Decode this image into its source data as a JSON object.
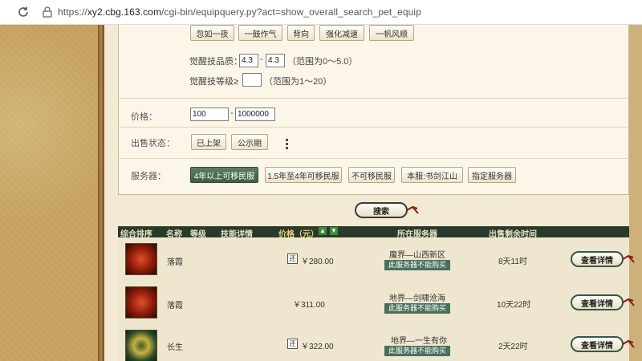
{
  "browser": {
    "url_prefix": "https://",
    "url_host": "xy2.cbg.163.com",
    "url_path": "/cgi-bin/equipquery.py?act=show_overall_search_pet_equip"
  },
  "skills": [
    "忽如一夜",
    "一鼓作气",
    "背向",
    "强化减速",
    "一帆风顺"
  ],
  "awaken_quality": {
    "label": "觉醒技品质：",
    "min": "4.3",
    "max": "4.3",
    "range_hint": "（范围为0～5.0）"
  },
  "awaken_level": {
    "label": "觉醒技等级≥",
    "value": "",
    "range_hint": "（范围为1～20）"
  },
  "price": {
    "label": "价格：",
    "min": "100",
    "max": "1000000"
  },
  "sale_status": {
    "label": "出售状态：",
    "options": [
      "已上架",
      "公示期"
    ]
  },
  "server": {
    "label": "服务器：",
    "options": [
      "4年以上可移民服",
      "1.5年至4年可移民服",
      "不可移民服",
      "本服:书剑江山",
      "指定服务器"
    ],
    "active_index": 0
  },
  "search_label": "搜索",
  "table": {
    "headers": [
      "综合排序",
      "名称",
      "等级",
      "技能详情",
      "价格（元）",
      "所在服务器",
      "出售剩余时间"
    ],
    "rows": [
      {
        "name": "落霞",
        "price_icon": "还",
        "price": "￥280.00",
        "server": "魔界—山西新区",
        "notice": "此服务器不能购买",
        "time": "8天11时",
        "button": "查看详情"
      },
      {
        "name": "落霞",
        "price_icon": "",
        "price": "￥311.00",
        "server": "地界—剑啸沧海",
        "notice": "此服务器不能购买",
        "time": "10天22时",
        "button": "查看详情"
      },
      {
        "name": "长生",
        "price_icon": "还",
        "price": "￥322.00",
        "server": "地界—一生有你",
        "notice": "此服务器不能购买",
        "time": "2天22时",
        "button": "查看详情"
      }
    ]
  },
  "colors": {
    "active_button": "#4a6a4f",
    "table_header": "#2a3a2a",
    "notice_badge": "#49705d"
  }
}
